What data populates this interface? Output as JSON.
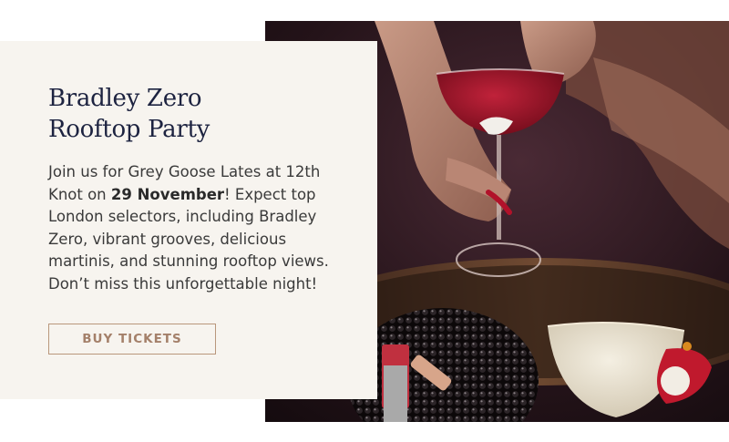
{
  "promo": {
    "title_line1": "Bradley Zero",
    "title_line2": "Rooftop Party",
    "desc_before": "Join us for Grey Goose Lates at 12th Knot on ",
    "desc_bold": "29 November",
    "desc_after": "! Expect top London selectors, including Bradley Zero, vibrant grooves, delicious martinis, and stunning rooftop views. Don’t miss this unforgettable night!",
    "cta_label": "BUY TICKETS"
  },
  "colors": {
    "title": "#1d2340",
    "card_bg": "#f7f4ef",
    "cta_border": "#b9977c",
    "cta_text": "#a4806a"
  }
}
